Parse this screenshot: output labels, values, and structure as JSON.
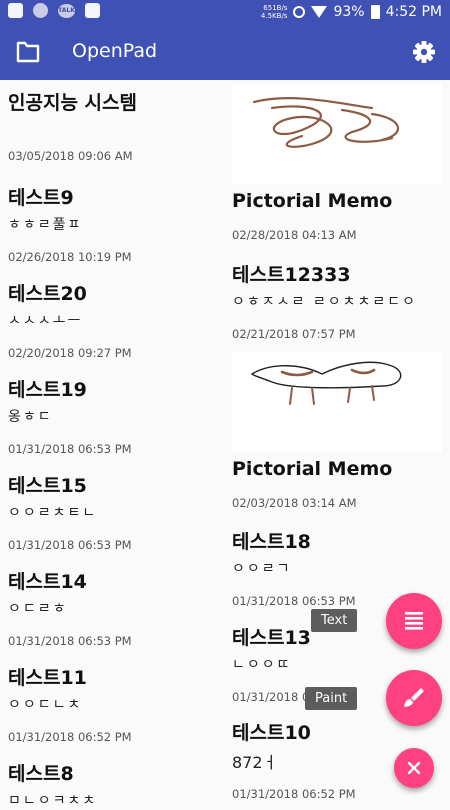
{
  "status": {
    "net_speed_up": "651B/s",
    "net_speed_down": "4.5KB/s",
    "battery": "93%",
    "time": "4:52 PM",
    "talk_label": "TALK"
  },
  "appbar": {
    "title": "OpenPad",
    "folder_icon": "folder-icon",
    "settings_icon": "gear-icon"
  },
  "notes_left": [
    {
      "title": "인공지능 시스템",
      "body": "",
      "date": "03/05/2018 09:06 AM"
    },
    {
      "title": "테스트9",
      "body": "ㅎㅎㄹ풀ㅍ",
      "date": "02/26/2018 10:19 PM"
    },
    {
      "title": "테스트20",
      "body": "ㅅㅅㅅㅗㅡ",
      "date": "02/20/2018 09:27 PM"
    },
    {
      "title": "테스트19",
      "body": "옹ㅎㄷ",
      "date": "01/31/2018 06:53 PM"
    },
    {
      "title": "테스트15",
      "body": "ㅇㅇㄹㅊㅌㄴ",
      "date": "01/31/2018 06:53 PM"
    },
    {
      "title": "테스트14",
      "body": "ㅇㄷㄹㅎ",
      "date": "01/31/2018 06:53 PM"
    },
    {
      "title": "테스트11",
      "body": "ㅇㅇㄷㄴㅊ",
      "date": "01/31/2018 06:52 PM"
    },
    {
      "title": "테스트8",
      "body": "ㅁㄴㅇㅋㅊㅊ",
      "date": ""
    }
  ],
  "notes_right": [
    {
      "title": "Pictorial Memo",
      "date": "02/28/2018 04:13 AM"
    },
    {
      "title": "테스트12333",
      "body": "ㅇㅎㅈㅅㄹ ㄹㅇㅊㅊㄹㄷㅇ",
      "date": "02/21/2018 07:57 PM"
    },
    {
      "title": "Pictorial Memo",
      "date": "02/03/2018 03:14 AM"
    },
    {
      "title": "테스트18",
      "body": "ㅇㅇㄹㄱ",
      "date": "01/31/2018 06:53 PM"
    },
    {
      "title": "테스트13",
      "body": "ㄴㅇㅇㄸ",
      "date": "01/31/2018 06:53 PM"
    },
    {
      "title": "테스트10",
      "body": "872ㅓ",
      "date": "01/31/2018 06:52 PM"
    }
  ],
  "fab": {
    "text_label": "Text",
    "paint_label": "Paint",
    "text_icon": "list-icon",
    "paint_icon": "brush-icon",
    "close_icon": "close-icon"
  },
  "colors": {
    "primary": "#3f51b5",
    "accent": "#ff4081",
    "drawing_stroke": "#8d5a44"
  }
}
